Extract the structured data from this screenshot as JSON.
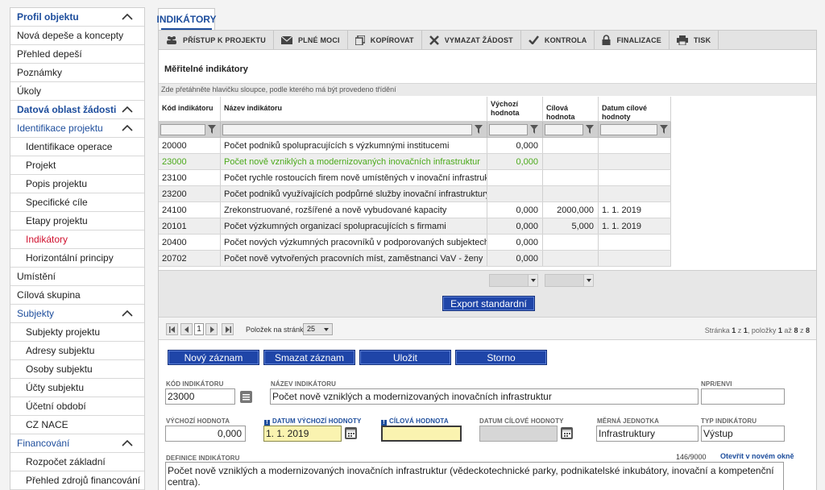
{
  "sidebar": {
    "items": [
      {
        "label": "Profil objektu",
        "type": "sec",
        "chevron": true
      },
      {
        "label": "Nová depeše a koncepty",
        "type": "item"
      },
      {
        "label": "Přehled depeší",
        "type": "item"
      },
      {
        "label": "Poznámky",
        "type": "item"
      },
      {
        "label": "Úkoly",
        "type": "item"
      },
      {
        "label": "Datová oblast žádosti",
        "type": "sec",
        "chevron": true
      },
      {
        "label": "Identifikace projektu",
        "type": "sec2",
        "chevron": true
      },
      {
        "label": "Identifikace operace",
        "type": "sub"
      },
      {
        "label": "Projekt",
        "type": "sub"
      },
      {
        "label": "Popis projektu",
        "type": "sub"
      },
      {
        "label": "Specifické cíle",
        "type": "sub"
      },
      {
        "label": "Etapy projektu",
        "type": "sub"
      },
      {
        "label": "Indikátory",
        "type": "sub active"
      },
      {
        "label": "Horizontální principy",
        "type": "sub"
      },
      {
        "label": "Umístění",
        "type": "item"
      },
      {
        "label": "Cílová skupina",
        "type": "item"
      },
      {
        "label": "Subjekty",
        "type": "sec2",
        "chevron": true
      },
      {
        "label": "Subjekty projektu",
        "type": "sub"
      },
      {
        "label": "Adresy subjektu",
        "type": "sub"
      },
      {
        "label": "Osoby subjektu",
        "type": "sub"
      },
      {
        "label": "Účty subjektu",
        "type": "sub"
      },
      {
        "label": "Účetní období",
        "type": "sub"
      },
      {
        "label": "CZ NACE",
        "type": "sub"
      },
      {
        "label": "Financování",
        "type": "sec2",
        "chevron": true
      },
      {
        "label": "Rozpočet základní",
        "type": "sub"
      },
      {
        "label": "Přehled zdrojů financování",
        "type": "sub"
      }
    ]
  },
  "tab": {
    "label": "INDIKÁTORY"
  },
  "toolbar": {
    "buttons": [
      {
        "label": "PŘÍSTUP K PROJEKTU",
        "icon": "people-icon"
      },
      {
        "label": "PLNÉ MOCI",
        "icon": "envelope-icon"
      },
      {
        "label": "KOPÍROVAT",
        "icon": "copy-icon"
      },
      {
        "label": "VYMAZAT ŽÁDOST",
        "icon": "delete-icon"
      },
      {
        "label": "KONTROLA",
        "icon": "check-icon"
      },
      {
        "label": "FINALIZACE",
        "icon": "lock-icon"
      },
      {
        "label": "TISK",
        "icon": "printer-icon"
      }
    ]
  },
  "section": {
    "title": "Měřitelné indikátory",
    "hint": "Zde přetáhněte hlavičku sloupce, podle kterého má být provedeno třídění"
  },
  "grid": {
    "headers": [
      "Kód indikátoru",
      "Název indikátoru",
      "Výchozí hodnota",
      "Cílová hodnota",
      "Datum cílové hodnoty"
    ],
    "rows": [
      [
        "20000",
        "Počet podniků spolupracujících s výzkumnými institucemi",
        "0,000",
        "",
        ""
      ],
      [
        "23000",
        "Počet nově vzniklých a modernizovaných inovačních infrastruktur",
        "0,000",
        "",
        ""
      ],
      [
        "23100",
        "Počet rychle rostoucích firem nově umístěných v inovační infrastruktuře",
        "",
        "",
        ""
      ],
      [
        "23200",
        "Počet podniků využívajících podpůrné služby inovační infrastruktury",
        "",
        "",
        ""
      ],
      [
        "24100",
        "Zrekonstruované, rozšířené a nově vybudované kapacity",
        "0,000",
        "2000,000",
        "1. 1. 2019"
      ],
      [
        "20101",
        "Počet výzkumných organizací spolupracujících s firmami",
        "0,000",
        "5,000",
        "1. 1. 2019"
      ],
      [
        "20400",
        "Počet nových výzkumných pracovníků v podporovaných subjektech",
        "0,000",
        "",
        ""
      ],
      [
        "20702",
        "Počet nově vytvořených pracovních míst, zaměstnanci VaV - ženy",
        "0,000",
        "",
        ""
      ]
    ],
    "selected_index": 1
  },
  "export": {
    "label": "Export standardní"
  },
  "pager": {
    "current_page": "1",
    "per_page_label": "Položek na stránku",
    "per_page_value": "25",
    "info_prefix": "Stránka",
    "page": "1",
    "of": "z",
    "pages": "1",
    "items_label": ", položky",
    "from": "1",
    "to_label": "až",
    "to": "8",
    "total": "8"
  },
  "actions": {
    "new": "Nový záznam",
    "delete": "Smazat záznam",
    "save": "Uložit",
    "cancel": "Storno"
  },
  "form": {
    "code_label": "KÓD INDIKÁTORU",
    "code_value": "23000",
    "name_label": "NÁZEV INDIKÁTORU",
    "name_value": "Počet nově vzniklých a modernizovaných inovačních infrastruktur",
    "npr_label": "NPR/ENVI",
    "npr_value": "",
    "start_value_label": "VÝCHOZÍ HODNOTA",
    "start_value": "0,000",
    "start_date_label": "DATUM VÝCHOZÍ HODNOTY",
    "start_date": "1. 1. 2019",
    "target_value_label": "CÍLOVÁ HODNOTA",
    "target_value": "",
    "target_date_label": "DATUM CÍLOVÉ HODNOTY",
    "target_date": "",
    "unit_label": "MĚRNÁ JEDNOTKA",
    "unit_value": "Infrastruktury",
    "type_label": "TYP INDIKÁTORU",
    "type_value": "Výstup",
    "definition_label": "DEFINICE INDIKÁTORU",
    "definition_counter": "146/9000",
    "definition_open": "Otevřít v novém okně",
    "definition_value": "Počet nově vzniklých a modernizovaných inovačních infrastruktur (vědeckotechnické parky, podnikatelské inkubátory, inovační a kompetenční centra).",
    "required_badge": "!"
  },
  "colors": {
    "accent": "#1d4d9c",
    "active": "#d0122f",
    "selected_row": "#4caa1c",
    "button": "#1f45a8"
  }
}
